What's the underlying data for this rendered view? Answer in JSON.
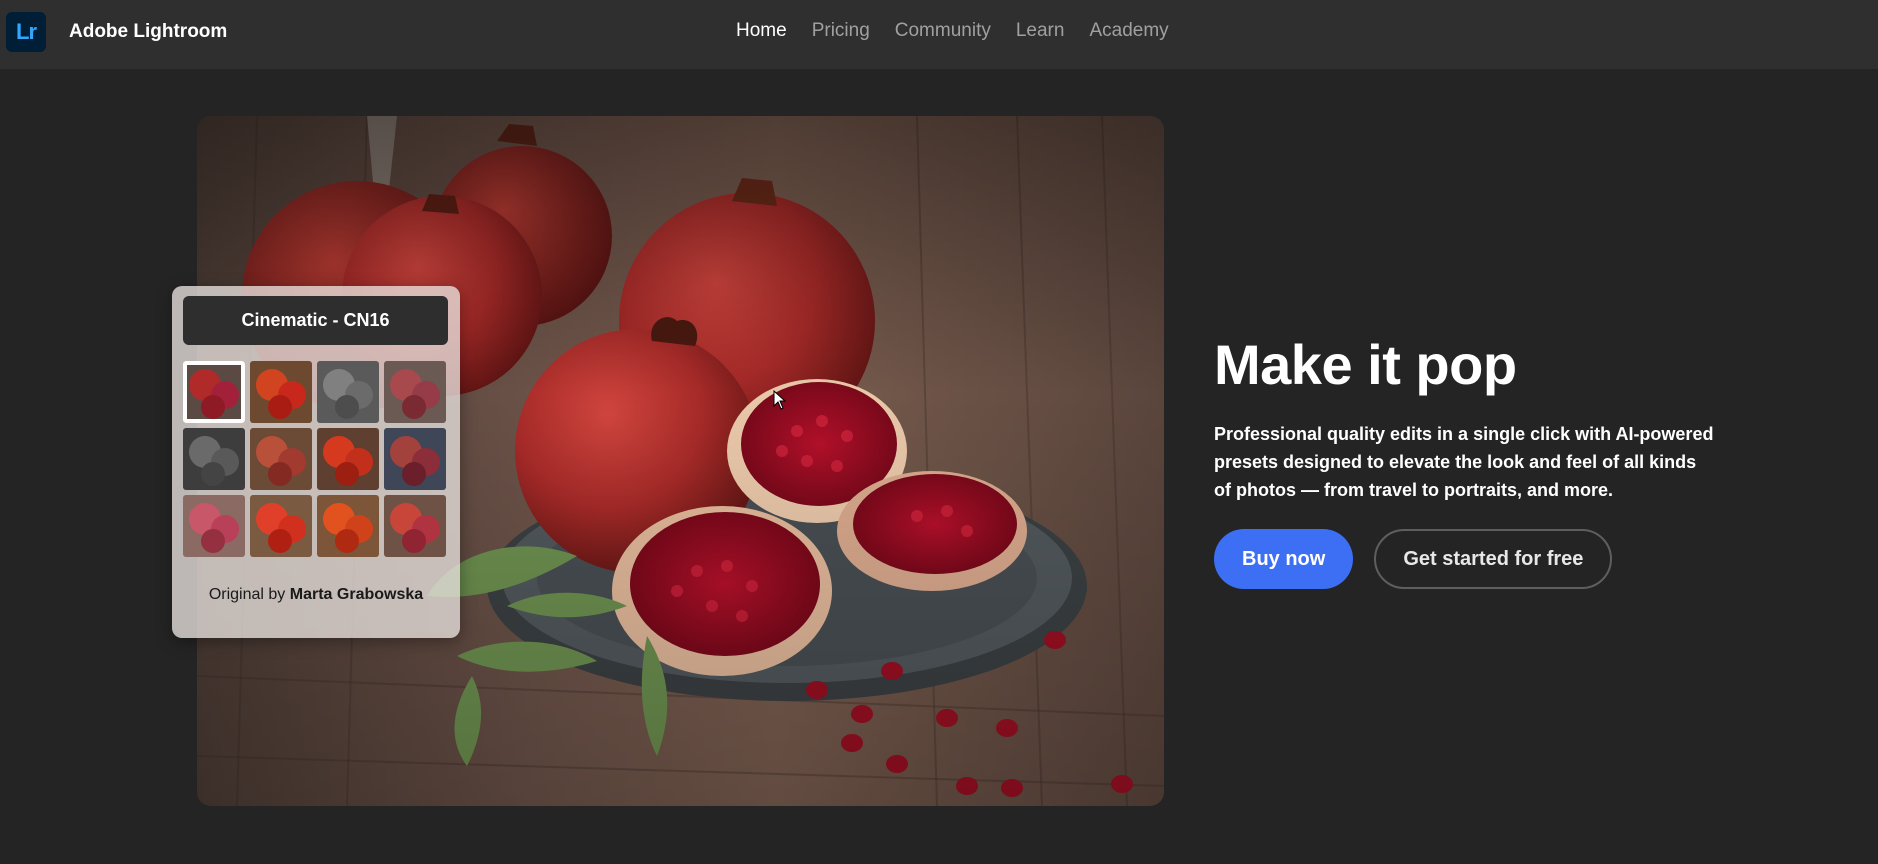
{
  "header": {
    "logo_text": "Lr",
    "brand": "Adobe Lightroom",
    "nav": [
      {
        "label": "Home",
        "active": true
      },
      {
        "label": "Pricing",
        "active": false
      },
      {
        "label": "Community",
        "active": false
      },
      {
        "label": "Learn",
        "active": false
      },
      {
        "label": "Academy",
        "active": false
      }
    ]
  },
  "preset_panel": {
    "title": "Cinematic - CN16",
    "selected_index": 0,
    "credit_prefix": "Original by",
    "credit_name": "Marta Grabowska"
  },
  "hero": {
    "headline": "Make it pop",
    "description": "Professional quality edits in a single click with AI-powered presets designed to elevate the look and feel of all kinds of photos — from travel to portraits, and more.",
    "primary_button": "Buy now",
    "secondary_button": "Get started for free"
  },
  "colors": {
    "background": "#242424",
    "navbar": "#2f2f2f",
    "accent_blue": "#3d6ff5",
    "logo_bg": "#001e36",
    "logo_fg": "#31a8ff"
  },
  "icons": {
    "logo": "lightroom-logo-icon",
    "cursor": "mouse-cursor-icon"
  }
}
